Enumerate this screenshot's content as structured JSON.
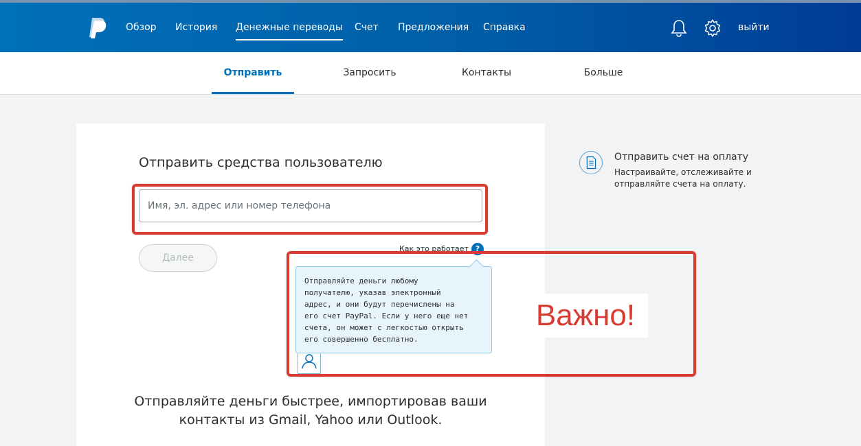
{
  "topnav": {
    "items": [
      {
        "label": "Обзор"
      },
      {
        "label": "История"
      },
      {
        "label": "Денежные переводы"
      },
      {
        "label": "Счет"
      },
      {
        "label": "Предложения"
      },
      {
        "label": "Справка"
      }
    ],
    "active_index": 2,
    "logout_label": "выйти",
    "icons": [
      "paypal-logo",
      "bell-icon",
      "gear-icon"
    ],
    "bar_color": "#0070ba"
  },
  "subnav": {
    "tabs": [
      {
        "label": "Отправить"
      },
      {
        "label": "Запросить"
      },
      {
        "label": "Контакты"
      },
      {
        "label": "Больше"
      }
    ],
    "active_index": 0,
    "accent_color": "#0070ba"
  },
  "send": {
    "title": "Отправить средства пользователю",
    "input_placeholder": "Имя, эл. адрес или номер телефона",
    "input_value": "",
    "next_label": "Далее",
    "how_it_works": "Как это работает",
    "help_glyph": "?"
  },
  "tooltip": {
    "lines": [
      "Отправляйте деньги любому",
      "получателю, указав электронный",
      "адрес, и они будут перечислены на",
      "его счет PayPal. Если у него еще нет",
      "счета, он может с легкостью открыть",
      "его совершенно бесплатно."
    ]
  },
  "import_contacts": {
    "line1": "Отправляйте деньги быстрее, импортировав ваши",
    "line2_prefix": "контакты из",
    "provider1": "Gmail",
    "provider2": "Yahoo",
    "connector": "или",
    "provider3": "Outlook"
  },
  "invoice": {
    "title": "Отправить счет на оплату",
    "description": "Настраивайте, отслеживайте и отправляйте счета на оплату.",
    "icon": "document-icon"
  },
  "annotation": {
    "label": "Важно!",
    "color": "#d93a31"
  }
}
